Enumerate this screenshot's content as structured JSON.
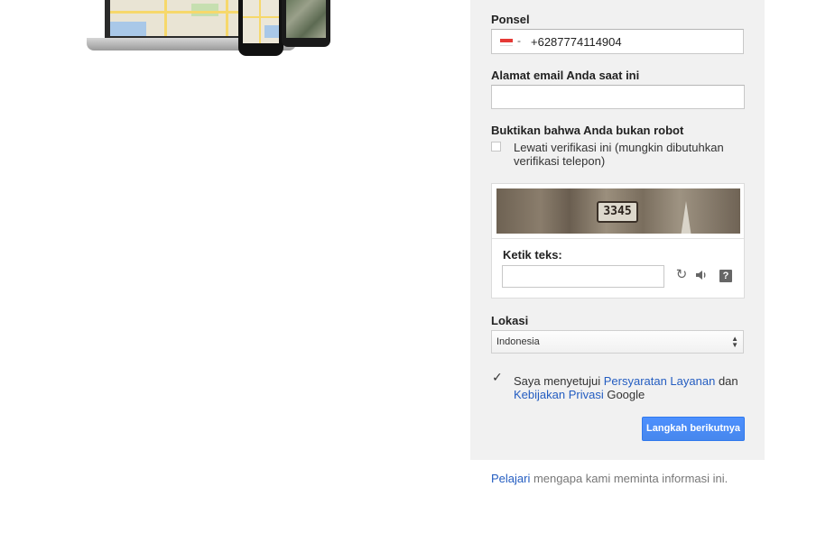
{
  "phone": {
    "label": "Ponsel",
    "country_flag": "indonesia-flag-icon",
    "country_dropdown_arrow": "-",
    "value": "+6287774114904"
  },
  "email": {
    "label": "Alamat email Anda saat ini",
    "value": ""
  },
  "robot": {
    "label": "Buktikan bahwa Anda bukan robot",
    "skip_checked": false,
    "skip_line1": "Lewati verifikasi ini (mungkin dibutuhkan",
    "skip_line2": "verifikasi telepon)"
  },
  "captcha": {
    "image_text": "3345",
    "input_label": "Ketik teks:",
    "input_value": "",
    "refresh_icon": "refresh-icon",
    "audio_icon": "audio-icon",
    "help_icon": "help-icon",
    "help_glyph": "?"
  },
  "location": {
    "label": "Lokasi",
    "selected": "Indonesia"
  },
  "terms": {
    "checked": true,
    "text_before": "Saya menyetujui ",
    "terms_link": "Persyaratan Layanan",
    "text_mid": " dan",
    "privacy_link": "Kebijakan Privasi",
    "text_after": " Google"
  },
  "next_button": "Langkah berikutnya",
  "footer": {
    "link": "Pelajari",
    "text": " mengapa kami meminta informasi ini."
  },
  "colors": {
    "panel_bg": "#f1f1f1",
    "link": "#245dc1",
    "button": "#4d90fe"
  }
}
